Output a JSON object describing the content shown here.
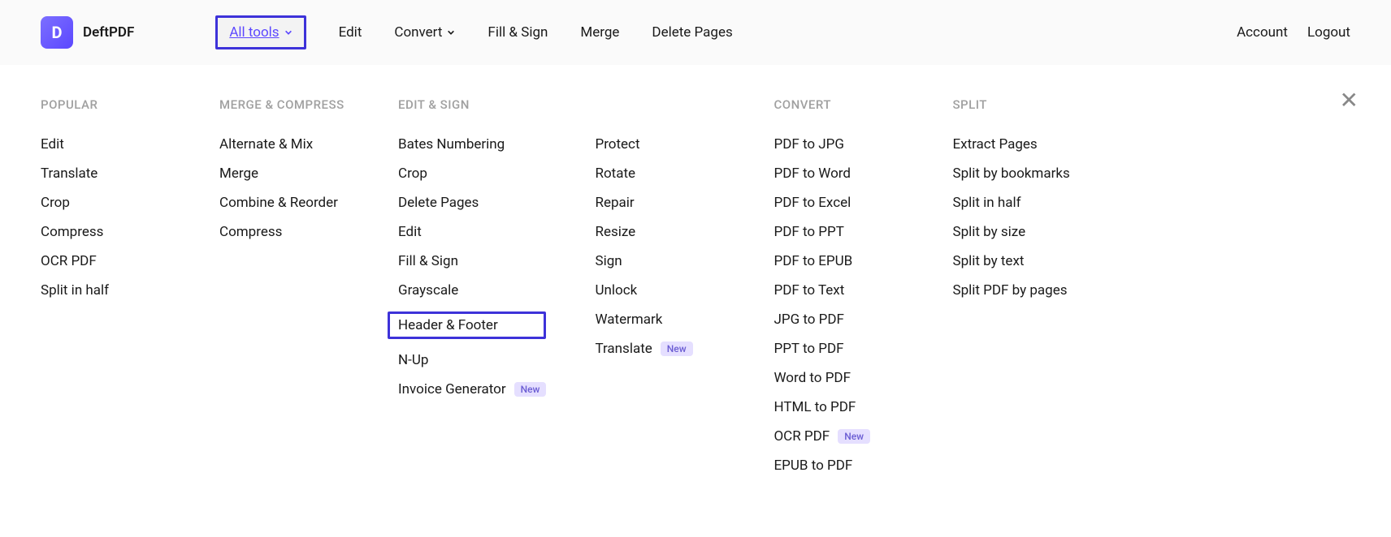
{
  "logo": {
    "letter": "D",
    "text": "DeftPDF"
  },
  "nav": {
    "all_tools": "All tools",
    "edit": "Edit",
    "convert": "Convert",
    "fill_sign": "Fill & Sign",
    "merge": "Merge",
    "delete_pages": "Delete Pages"
  },
  "right_nav": {
    "account": "Account",
    "logout": "Logout"
  },
  "badges": {
    "new": "New"
  },
  "mega": {
    "popular": {
      "header": "POPULAR",
      "items": [
        "Edit",
        "Translate",
        "Crop",
        "Compress",
        "OCR PDF",
        "Split in half"
      ]
    },
    "merge_compress": {
      "header": "MERGE & COMPRESS",
      "items": [
        "Alternate & Mix",
        "Merge",
        "Combine & Reorder",
        "Compress"
      ]
    },
    "edit_sign": {
      "header": "EDIT & SIGN",
      "items_a": [
        "Bates Numbering",
        "Crop",
        "Delete Pages",
        "Edit",
        "Fill & Sign",
        "Grayscale",
        "Header & Footer",
        "N-Up",
        "Invoice Generator"
      ],
      "items_b": [
        "Protect",
        "Rotate",
        "Repair",
        "Resize",
        "Sign",
        "Unlock",
        "Watermark",
        "Translate"
      ]
    },
    "convert": {
      "header": "CONVERT",
      "items": [
        "PDF to JPG",
        "PDF to Word",
        "PDF to Excel",
        "PDF to PPT",
        "PDF to EPUB",
        "PDF to Text",
        "JPG to PDF",
        "PPT to PDF",
        "Word to PDF",
        "HTML to PDF",
        "OCR PDF",
        "EPUB to PDF"
      ]
    },
    "split": {
      "header": "SPLIT",
      "items": [
        "Extract Pages",
        "Split by bookmarks",
        "Split in half",
        "Split by size",
        "Split by text",
        "Split PDF by pages"
      ]
    }
  }
}
